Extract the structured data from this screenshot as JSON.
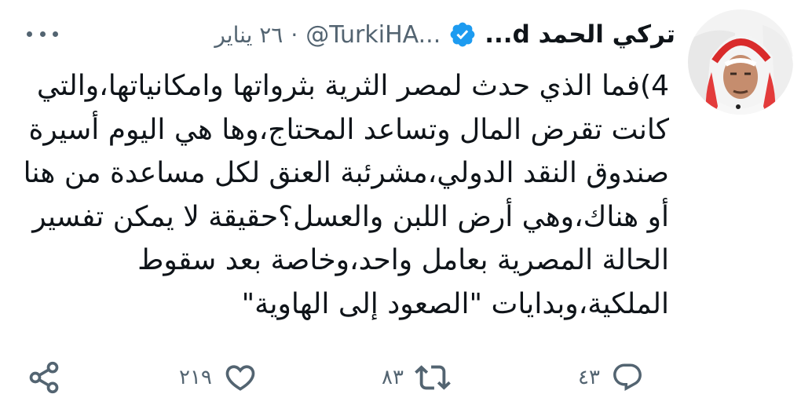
{
  "tweet": {
    "display_name": "تركي الحمد d...",
    "handle": "@TurkiHA...",
    "separator": "·",
    "date": "٢٦ يناير",
    "lines": [
      "4)فما الذي حدث لمصر الثرية بثرواتها وامكانياتها،والتي",
      "كانت تقرض المال وتساعد المحتاج،وها هي اليوم أسيرة",
      "صندوق النقد الدولي،مشرئبة العنق لكل مساعدة من هنا",
      "أو هناك،وهي أرض اللبن والعسل؟حقيقة لا يمكن تفسير",
      "الحالة المصرية بعامل واحد،وخاصة بعد سقوط",
      "الملكية،وبدايات \"الصعود إلى الهاوية\""
    ]
  },
  "actions": {
    "replies": "٤٣",
    "retweets": "٨٣",
    "likes": "٢١٩"
  },
  "icons": {
    "verified": "verified-badge-icon",
    "more": "more-options-icon",
    "reply": "reply-icon",
    "retweet": "retweet-icon",
    "like": "heart-icon",
    "share": "share-icon"
  },
  "colors": {
    "verified": "#1d9bf0",
    "text": "#0f1419",
    "secondary": "#536471"
  }
}
